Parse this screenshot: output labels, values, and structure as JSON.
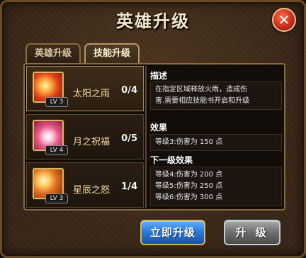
{
  "dialog": {
    "title": "英雄升级",
    "close_icon": "close-x-icon"
  },
  "tabs": [
    {
      "label": "英雄升级",
      "active": false
    },
    {
      "label": "技能升级",
      "active": true
    }
  ],
  "skills": [
    {
      "name": "太阳之雨",
      "count": "0/4",
      "level": "LV 3",
      "icon": "sun-rain-skill-icon",
      "selected": true
    },
    {
      "name": "月之祝福",
      "count": "0/5",
      "level": "LV 4",
      "icon": "moon-blessing-skill-icon",
      "selected": false
    },
    {
      "name": "星辰之怒",
      "count": "1/4",
      "level": "LV 3",
      "icon": "star-wrath-skill-icon",
      "selected": false
    }
  ],
  "info": {
    "desc_title": "描述",
    "desc_lines": [
      "在指定区域释放火雨，造成伤",
      "害.需要相应技能书开启和升级"
    ],
    "effect_title": "效果",
    "effect_line": "等级3:伤害为 150 点",
    "next_title": "下一级效果",
    "next_lines": [
      "等级4:伤害为 200 点",
      "等级5:伤害为 250 点",
      "等级6:伤害为 300 点"
    ]
  },
  "buttons": {
    "upgrade_now": "立即升级",
    "upgrade": "升 级"
  },
  "colors": {
    "upgrade_now": "#2a78d6",
    "upgrade": "#6e6e6e",
    "close": "#c2281a"
  }
}
